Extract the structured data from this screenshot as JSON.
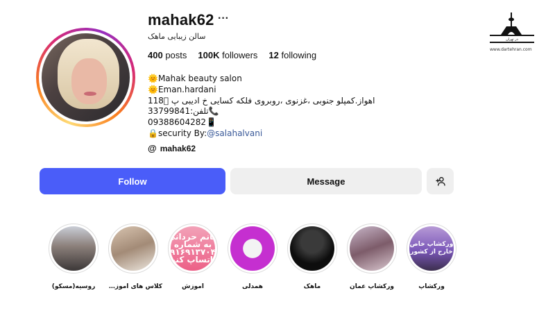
{
  "profile": {
    "username": "mahak62",
    "more_icon": "···",
    "full_name": "سالن زیبایی ماهک",
    "stats": {
      "posts_count": "400",
      "posts_label": "posts",
      "followers_count": "100K",
      "followers_label": "followers",
      "following_count": "12",
      "following_label": "following"
    },
    "bio": {
      "line1": "🌞Mahak beauty salon",
      "line2": "🌞Eman.hardani",
      "line3": "اهواز.کمپلو جنوبی ،غزنوی ،روبروی فلکه کسایی خ ادیبی پ 118🏻",
      "line4": "33799841:تلفن📞",
      "line5": "09388604282📱",
      "line6_prefix": "🔒security By:",
      "line6_link": "@salahalvani"
    },
    "threads_handle": "mahak62"
  },
  "actions": {
    "follow_label": "Follow",
    "message_label": "Message",
    "add_user_icon": "add-user-icon"
  },
  "watermark": {
    "site": "www.dartehran.com"
  },
  "highlights": [
    {
      "label": "روسیه(مسکو)",
      "text": ""
    },
    {
      "label": "کلاس های آموزش...",
      "text": ""
    },
    {
      "label": "آموزش",
      "text": "خانم حردانی به شماره ۰۹۱۶۹۱۳۷۰۴۸ واتساپ کنید"
    },
    {
      "label": "همدلی",
      "text": ""
    },
    {
      "label": "ماهک",
      "text": ""
    },
    {
      "label": "ورکشاپ عمان",
      "text": ""
    },
    {
      "label": "ورکشاپ",
      "text": "ورکشاپ خاص خارج از کشور"
    }
  ],
  "colors": {
    "follow_bg": "#4a5df9",
    "secondary_bg": "#efefef",
    "link": "#385898"
  }
}
